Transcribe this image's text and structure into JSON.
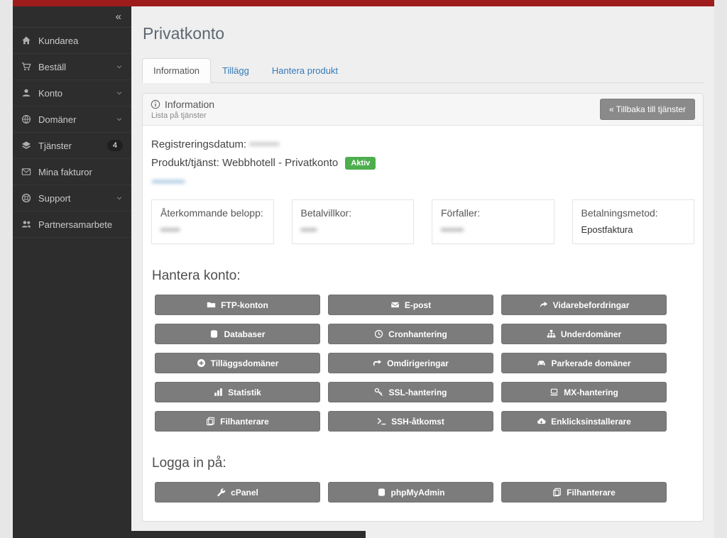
{
  "page": {
    "title": "Privatkonto"
  },
  "colors": {
    "accent_red": "#9e1c1c",
    "status_green": "#4cae4c",
    "link_blue": "#337ab7",
    "button_gray": "#7c7c7c",
    "sidebar_dark": "#2e2d2d"
  },
  "sidebar": {
    "collapse_icon": "«",
    "items": [
      {
        "label": "Kundarea",
        "icon": "home"
      },
      {
        "label": "Beställ",
        "icon": "cart",
        "chevron": true
      },
      {
        "label": "Konto",
        "icon": "user",
        "chevron": true
      },
      {
        "label": "Domäner",
        "icon": "globe",
        "chevron": true
      },
      {
        "label": "Tjänster",
        "icon": "layers",
        "badge": "4"
      },
      {
        "label": "Mina fakturor",
        "icon": "envelope"
      },
      {
        "label": "Support",
        "icon": "life-ring",
        "chevron": true
      },
      {
        "label": "Partnersamarbete",
        "icon": "users"
      }
    ]
  },
  "tabs": [
    {
      "label": "Information",
      "active": true
    },
    {
      "label": "Tillägg",
      "active": false
    },
    {
      "label": "Hantera produkt",
      "active": false
    }
  ],
  "panel": {
    "header": {
      "title": "Information",
      "subtitle": "Lista på tjänster",
      "back_button": "« Tillbaka till tjänster"
    },
    "registration": {
      "label": "Registreringsdatum:",
      "value": "••••••••",
      "masked": true
    },
    "product": {
      "label": "Produkt/tjänst:",
      "value": "Webbhotell - Privatkonto",
      "status": "Aktiv"
    },
    "domain_link": "•••••••••••",
    "info_boxes": [
      {
        "label": "Återkommande belopp:",
        "value": "••••••",
        "masked": true
      },
      {
        "label": "Betalvillkor:",
        "value": "•••••",
        "masked": true
      },
      {
        "label": "Förfaller:",
        "value": "•••••••",
        "masked": true
      },
      {
        "label": "Betalningsmetod:",
        "value": "Epostfaktura",
        "masked": false
      }
    ],
    "manage": {
      "heading": "Hantera konto:",
      "buttons": [
        {
          "label": "FTP-konton",
          "icon": "folder"
        },
        {
          "label": "E-post",
          "icon": "mail"
        },
        {
          "label": "Vidarebefordringar",
          "icon": "share"
        },
        {
          "label": "Databaser",
          "icon": "database"
        },
        {
          "label": "Cronhantering",
          "icon": "clock"
        },
        {
          "label": "Underdomäner",
          "icon": "sitemap"
        },
        {
          "label": "Tilläggsdomäner",
          "icon": "plus"
        },
        {
          "label": "Omdirigeringar",
          "icon": "redirect"
        },
        {
          "label": "Parkerade domäner",
          "icon": "car"
        },
        {
          "label": "Statistik",
          "icon": "chart"
        },
        {
          "label": "SSL-hantering",
          "icon": "key"
        },
        {
          "label": "MX-hantering",
          "icon": "laptop"
        },
        {
          "label": "Filhanterare",
          "icon": "copy"
        },
        {
          "label": "SSH-åtkomst",
          "icon": "terminal"
        },
        {
          "label": "Enklicksinstallerare",
          "icon": "cloud"
        }
      ]
    },
    "login": {
      "heading": "Logga in på:",
      "buttons": [
        {
          "label": "cPanel",
          "icon": "wrench"
        },
        {
          "label": "phpMyAdmin",
          "icon": "database"
        },
        {
          "label": "Filhanterare",
          "icon": "copy"
        }
      ]
    }
  }
}
